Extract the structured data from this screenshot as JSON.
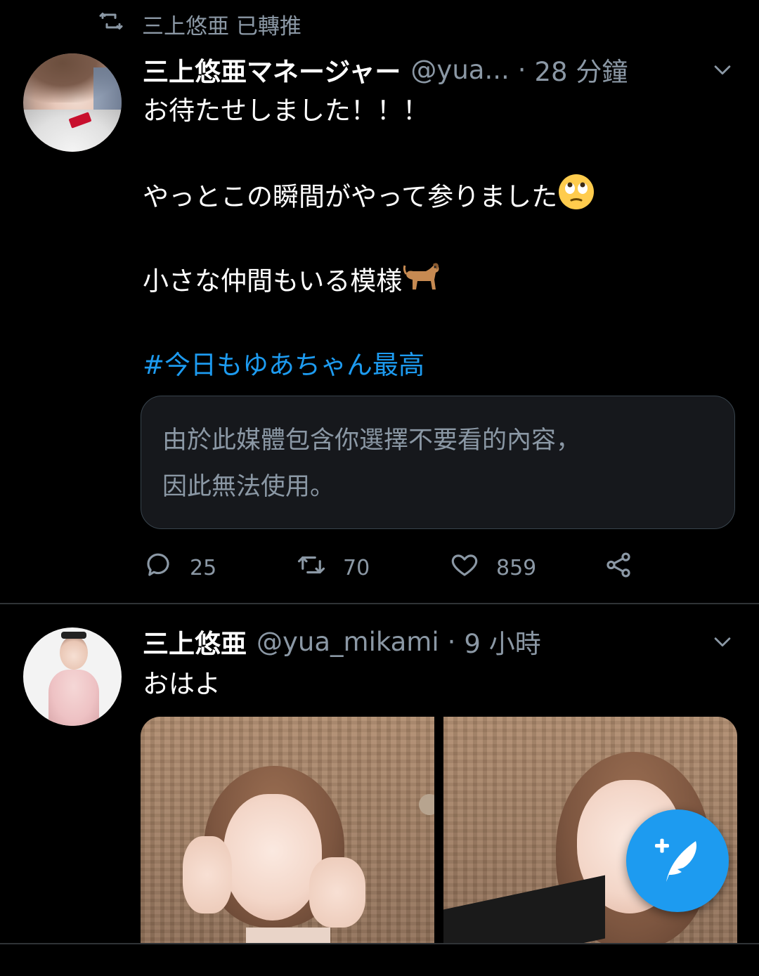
{
  "tweet1": {
    "retweet_label": "三上悠亜 已轉推",
    "name": "三上悠亜マネージャー",
    "handle": "@yua...",
    "separator": "·",
    "time": "28 分鐘",
    "lines": [
      "お待たせしました！！！",
      "やっとこの瞬間がやって参りました",
      "小さな仲間もいる模様",
      "#今日もゆあちゃん最高"
    ],
    "media_warning": [
      "由於此媒體包含你選擇不要看的內容，",
      "因此無法使用。"
    ],
    "reply_count": "25",
    "retweet_count": "70",
    "like_count": "859"
  },
  "tweet2": {
    "name": "三上悠亜",
    "handle": "@yua_mikami",
    "separator": "·",
    "time": "9 小時",
    "text": "おはよ"
  },
  "colors": {
    "accent": "#1d9bf0",
    "muted": "#8b98a5",
    "background": "#000000"
  }
}
